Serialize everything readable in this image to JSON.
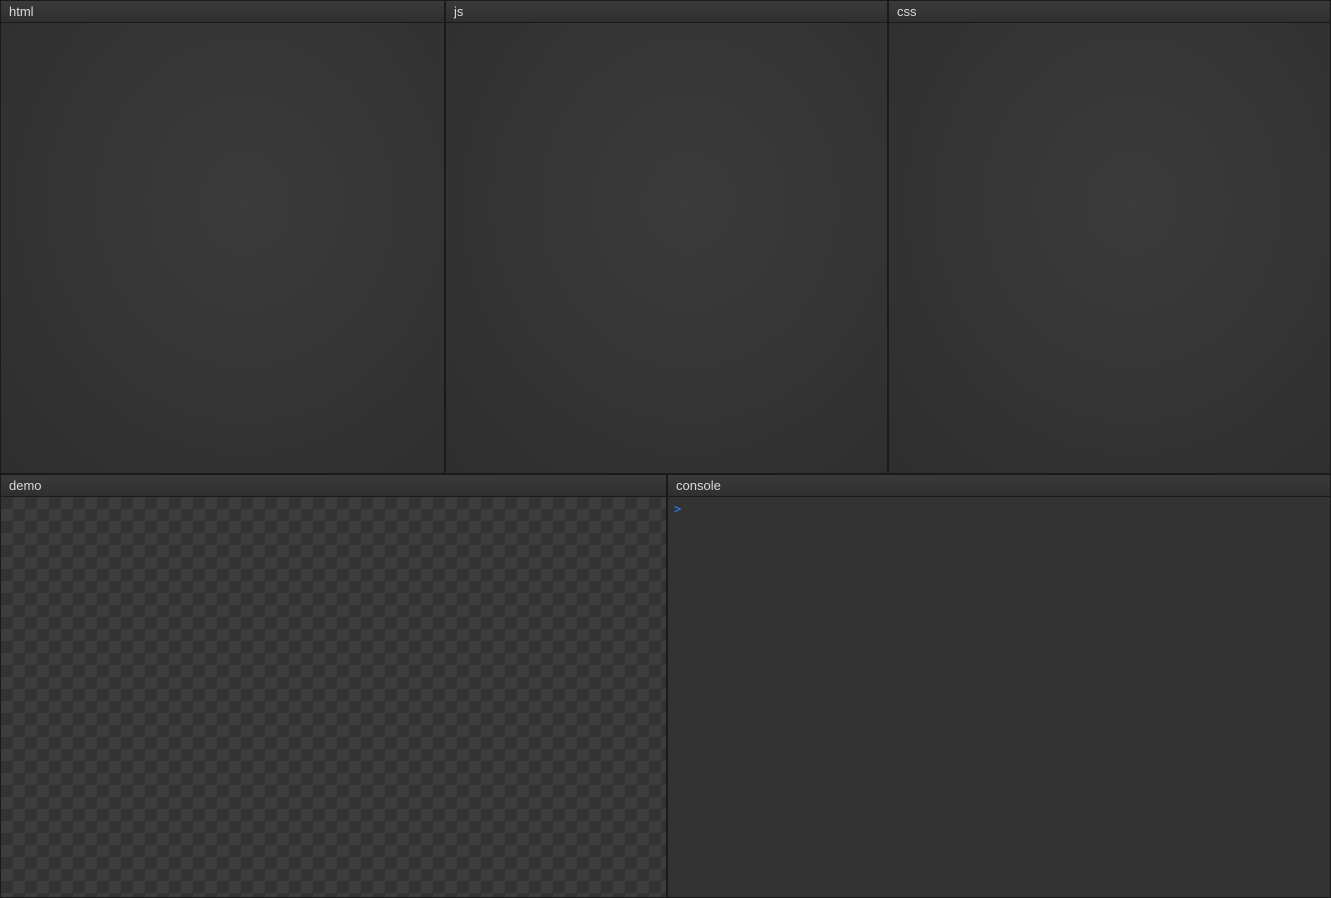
{
  "panels": {
    "html": {
      "title": "html",
      "content": ""
    },
    "js": {
      "title": "js",
      "content": ""
    },
    "css": {
      "title": "css",
      "content": ""
    },
    "demo": {
      "title": "demo"
    },
    "console": {
      "title": "console",
      "prompt": ">",
      "input": ""
    }
  }
}
